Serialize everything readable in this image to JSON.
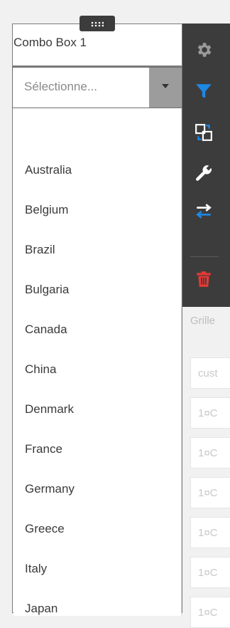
{
  "widget": {
    "title": "Combo Box 1",
    "combo_placeholder": "Sélectionne..."
  },
  "dropdown": {
    "items": [
      "Australia",
      "Belgium",
      "Brazil",
      "Bulgaria",
      "Canada",
      "China",
      "Denmark",
      "France",
      "Germany",
      "Greece",
      "Italy",
      "Japan"
    ]
  },
  "toolbar": {
    "icons": [
      "gear-icon",
      "filter-icon",
      "convert-icon",
      "wrench-icon",
      "swap-arrows-icon",
      "trash-icon"
    ],
    "colors": {
      "background": "#3c3c3c",
      "accent": "#1e88e5",
      "danger": "#e53935"
    }
  },
  "background_grid": {
    "title": "Grille",
    "column_header": "cust",
    "cells": [
      "1¤C",
      "1¤C",
      "1¤C",
      "1¤C",
      "1¤C",
      "1¤C"
    ]
  }
}
